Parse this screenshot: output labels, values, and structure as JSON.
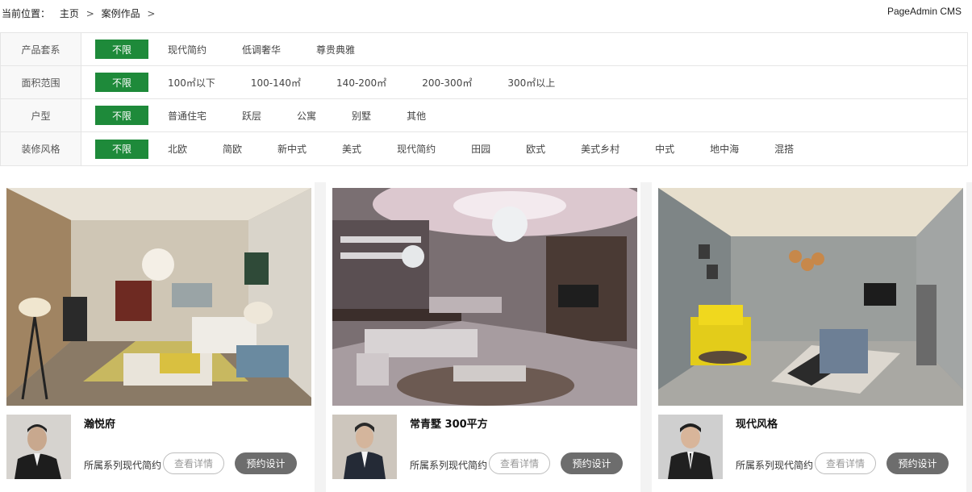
{
  "breadcrumb": {
    "prefix": "当前位置：",
    "items": [
      "主页",
      "案例作品"
    ],
    "separator": ">"
  },
  "brand": "PageAdmin CMS",
  "filters": [
    {
      "label": "产品套系",
      "all_label": "不限",
      "options": [
        "现代简约",
        "低调奢华",
        "尊贵典雅"
      ]
    },
    {
      "label": "面积范围",
      "all_label": "不限",
      "options": [
        "100㎡以下",
        "100-140㎡",
        "140-200㎡",
        "200-300㎡",
        "300㎡以上"
      ]
    },
    {
      "label": "户型",
      "all_label": "不限",
      "options": [
        "普通住宅",
        "跃层",
        "公寓",
        "别墅",
        "其他"
      ]
    },
    {
      "label": "装修风格",
      "all_label": "不限",
      "options": [
        "北欧",
        "简欧",
        "新中式",
        "美式",
        "现代简约",
        "田园",
        "欧式",
        "美式乡村",
        "中式",
        "地中海",
        "混搭"
      ]
    }
  ],
  "cards": [
    {
      "title": "瀚悦府",
      "series_label": "所属系列现代简约",
      "detail_label": "查看详情",
      "book_label": "预约设计"
    },
    {
      "title": "常青墅 300平方",
      "series_label": "所属系列现代简约",
      "detail_label": "查看详情",
      "book_label": "预约设计"
    },
    {
      "title": "现代风格",
      "series_label": "所属系列现代简约",
      "detail_label": "查看详情",
      "book_label": "预约设计"
    }
  ],
  "colors": {
    "accent": "#1e8a3a",
    "book_button": "#6d6d6d",
    "card_area_bg": "#f3f3f3"
  }
}
